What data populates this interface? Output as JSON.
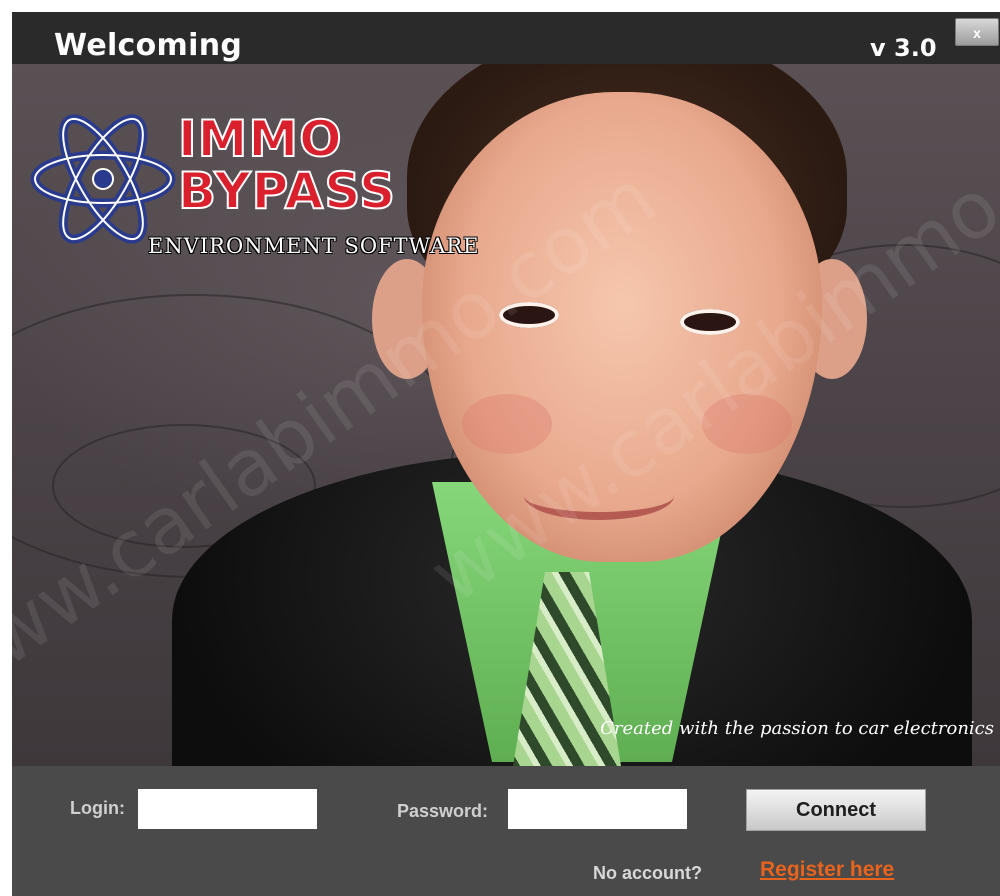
{
  "window": {
    "title": "Welcoming",
    "version": "v 3.0",
    "close_label": "x"
  },
  "logo": {
    "line1": "IMMO",
    "line2": "BYPASS",
    "subtitle": "ENVIRONMENT SOFTWARE",
    "icon": "atom-icon"
  },
  "tagline": "Created with the passion to car electronics",
  "form": {
    "login_label": "Login:",
    "login_value": "",
    "password_label": "Password:",
    "password_value": "",
    "connect_label": "Connect"
  },
  "footer": {
    "no_account_text": "No account?",
    "register_link": "Register here"
  },
  "watermark": "www.carlabimmo.com",
  "colors": {
    "logo_red": "#d9202c",
    "logo_blue": "#2a3a8c",
    "register_orange": "#e8631c",
    "shirt_green": "#7ccc6e",
    "title_bar": "#2a2a2a"
  }
}
